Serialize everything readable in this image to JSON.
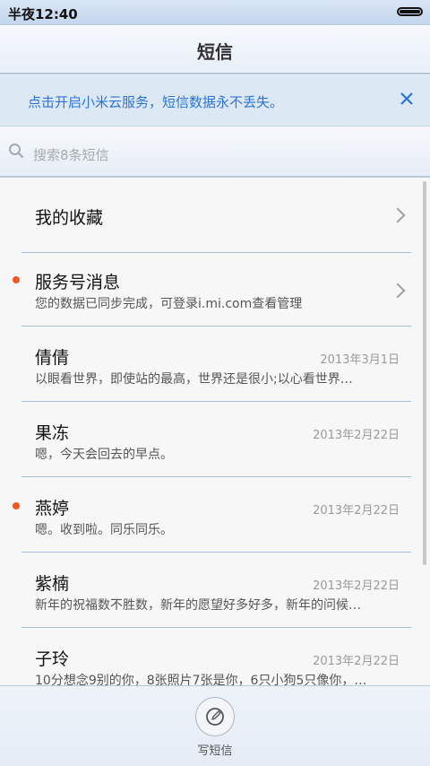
{
  "status_bar": {
    "time": "半夜12:40",
    "battery_icon": "battery-full-icon"
  },
  "header": {
    "title": "短信"
  },
  "banner": {
    "text": "点击开启小米云服务，短信数据永不丢失。",
    "close_icon": "close-icon",
    "accent": "#2b74d3"
  },
  "search": {
    "placeholder": "搜索8条短信"
  },
  "conversations": [
    {
      "name": "我的收藏",
      "preview": "",
      "date": "",
      "unread": false,
      "chevron": true
    },
    {
      "name": "服务号消息",
      "preview": "您的数据已同步完成，可登录i.mi.com查看管理",
      "date": "",
      "unread": true,
      "chevron": true
    },
    {
      "name": "倩倩",
      "preview": "以眼看世界，即使站的最高，世界还是很小;以心看世界…",
      "date": "2013年3月1日",
      "unread": false,
      "chevron": false
    },
    {
      "name": "果冻",
      "preview": "嗯，今天会回去的早点。",
      "date": "2013年2月22日",
      "unread": false,
      "chevron": false
    },
    {
      "name": "燕婷",
      "preview": "嗯。收到啦。同乐同乐。",
      "date": "2013年2月22日",
      "unread": true,
      "chevron": false
    },
    {
      "name": "紫楠",
      "preview": "新年的祝福数不胜数，新年的愿望好多好多，新年的问候…",
      "date": "2013年2月22日",
      "unread": false,
      "chevron": false
    },
    {
      "name": "子玲",
      "preview": "10分想念9别的你，8张照片7张是你，6只小狗5只像你，…",
      "date": "2013年2月22日",
      "unread": false,
      "chevron": false
    }
  ],
  "unread_color": "#f05a1e",
  "bottom": {
    "compose_label": "写短信",
    "compose_icon": "compose-icon"
  }
}
